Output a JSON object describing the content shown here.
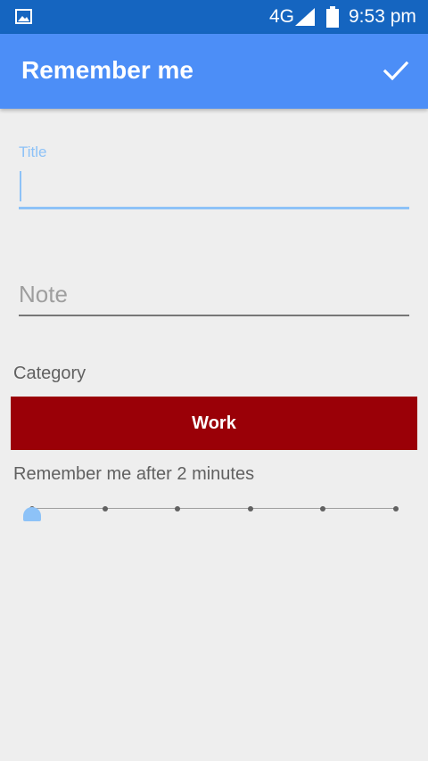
{
  "status_bar": {
    "network": "4G",
    "time": "9:53 pm"
  },
  "app_bar": {
    "title": "Remember me"
  },
  "form": {
    "title_label": "Title",
    "title_value": "",
    "note_placeholder": "Note",
    "note_value": "",
    "category_label": "Category",
    "category_value": "Work",
    "category_color": "#9a0007",
    "remember_label": "Remember me after 2 minutes",
    "slider": {
      "steps": 6,
      "selected_index": 0
    }
  },
  "colors": {
    "status_bar": "#1565c0",
    "app_bar": "#4c8ef7",
    "accent": "#8dc2f7",
    "background": "#eeeeee"
  }
}
